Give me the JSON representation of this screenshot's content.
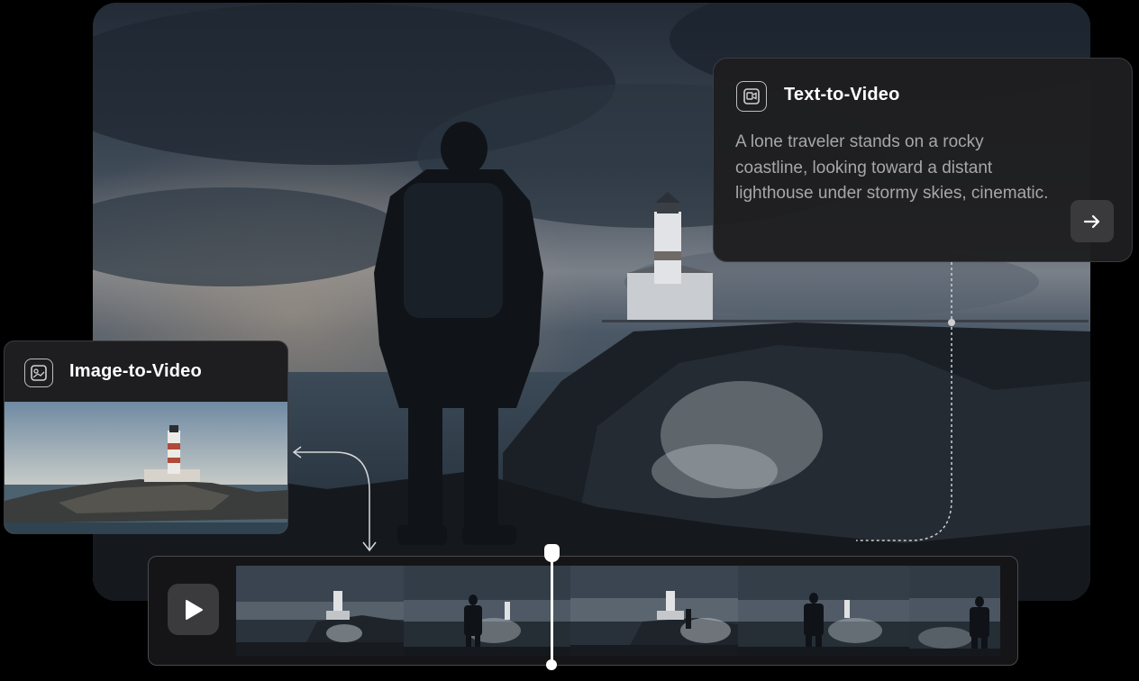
{
  "text_to_video": {
    "title": "Text-to-Video",
    "icon": "text-to-video-icon",
    "prompt": "A lone traveler stands on a rocky coastline, looking toward a distant lighthouse under stormy skies, cinematic.",
    "send_icon": "arrow-right-icon"
  },
  "image_to_video": {
    "title": "Image-to-Video",
    "icon": "image-to-video-icon"
  },
  "timeline": {
    "play_icon": "play-icon",
    "frames": [
      {
        "name": "frame-1",
        "subject": "lighthouse"
      },
      {
        "name": "frame-2",
        "subject": "traveler"
      },
      {
        "name": "frame-3",
        "subject": "lighthouse"
      },
      {
        "name": "frame-4",
        "subject": "traveler"
      },
      {
        "name": "frame-5",
        "subject": "traveler"
      }
    ]
  },
  "colors": {
    "card_bg": "#1e1e20",
    "card_border": "#3b3b3f",
    "prompt_text": "#a7a7a9",
    "button_bg": "#3a3a3d",
    "playhead": "#ffffff"
  }
}
